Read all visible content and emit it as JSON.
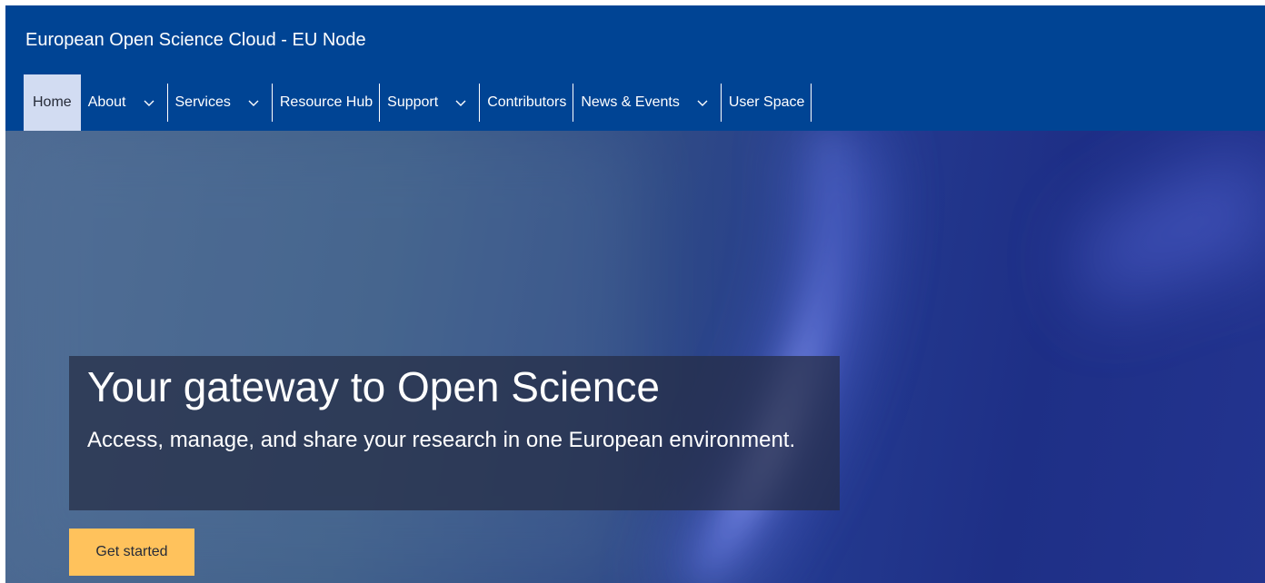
{
  "header": {
    "site_title": "European Open Science Cloud - EU Node",
    "background_color": "#004494"
  },
  "nav": {
    "items": [
      {
        "label": "Home",
        "active": true,
        "has_dropdown": false
      },
      {
        "label": "About",
        "active": false,
        "has_dropdown": true
      },
      {
        "label": "Services",
        "active": false,
        "has_dropdown": true
      },
      {
        "label": "Resource Hub",
        "active": false,
        "has_dropdown": false
      },
      {
        "label": "Support",
        "active": false,
        "has_dropdown": true
      },
      {
        "label": "Contributors",
        "active": false,
        "has_dropdown": false
      },
      {
        "label": "News & Events",
        "active": false,
        "has_dropdown": true
      },
      {
        "label": "User Space",
        "active": false,
        "has_dropdown": false
      }
    ],
    "dropdown_icon": "chevron-down-icon",
    "active_color": "#d2dcf2"
  },
  "hero": {
    "title": "Your gateway to Open Science",
    "subtitle": "Access, manage, and share your research in one European environment.",
    "cta_label": "Get started",
    "cta_color": "#ffc25c"
  }
}
